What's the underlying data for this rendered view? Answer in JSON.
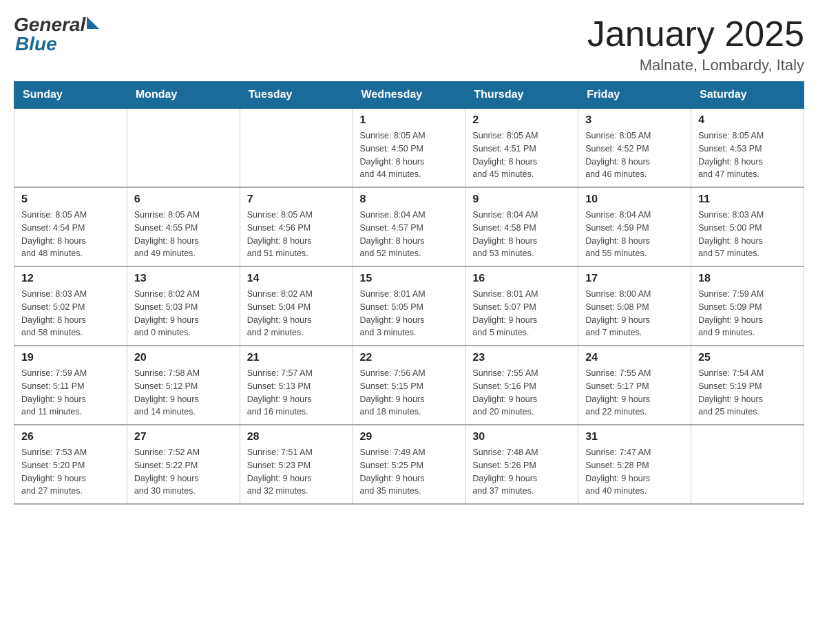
{
  "header": {
    "logo_general": "General",
    "logo_blue": "Blue",
    "month_title": "January 2025",
    "location": "Malnate, Lombardy, Italy"
  },
  "weekdays": [
    "Sunday",
    "Monday",
    "Tuesday",
    "Wednesday",
    "Thursday",
    "Friday",
    "Saturday"
  ],
  "weeks": [
    [
      {
        "day": "",
        "info": ""
      },
      {
        "day": "",
        "info": ""
      },
      {
        "day": "",
        "info": ""
      },
      {
        "day": "1",
        "info": "Sunrise: 8:05 AM\nSunset: 4:50 PM\nDaylight: 8 hours\nand 44 minutes."
      },
      {
        "day": "2",
        "info": "Sunrise: 8:05 AM\nSunset: 4:51 PM\nDaylight: 8 hours\nand 45 minutes."
      },
      {
        "day": "3",
        "info": "Sunrise: 8:05 AM\nSunset: 4:52 PM\nDaylight: 8 hours\nand 46 minutes."
      },
      {
        "day": "4",
        "info": "Sunrise: 8:05 AM\nSunset: 4:53 PM\nDaylight: 8 hours\nand 47 minutes."
      }
    ],
    [
      {
        "day": "5",
        "info": "Sunrise: 8:05 AM\nSunset: 4:54 PM\nDaylight: 8 hours\nand 48 minutes."
      },
      {
        "day": "6",
        "info": "Sunrise: 8:05 AM\nSunset: 4:55 PM\nDaylight: 8 hours\nand 49 minutes."
      },
      {
        "day": "7",
        "info": "Sunrise: 8:05 AM\nSunset: 4:56 PM\nDaylight: 8 hours\nand 51 minutes."
      },
      {
        "day": "8",
        "info": "Sunrise: 8:04 AM\nSunset: 4:57 PM\nDaylight: 8 hours\nand 52 minutes."
      },
      {
        "day": "9",
        "info": "Sunrise: 8:04 AM\nSunset: 4:58 PM\nDaylight: 8 hours\nand 53 minutes."
      },
      {
        "day": "10",
        "info": "Sunrise: 8:04 AM\nSunset: 4:59 PM\nDaylight: 8 hours\nand 55 minutes."
      },
      {
        "day": "11",
        "info": "Sunrise: 8:03 AM\nSunset: 5:00 PM\nDaylight: 8 hours\nand 57 minutes."
      }
    ],
    [
      {
        "day": "12",
        "info": "Sunrise: 8:03 AM\nSunset: 5:02 PM\nDaylight: 8 hours\nand 58 minutes."
      },
      {
        "day": "13",
        "info": "Sunrise: 8:02 AM\nSunset: 5:03 PM\nDaylight: 9 hours\nand 0 minutes."
      },
      {
        "day": "14",
        "info": "Sunrise: 8:02 AM\nSunset: 5:04 PM\nDaylight: 9 hours\nand 2 minutes."
      },
      {
        "day": "15",
        "info": "Sunrise: 8:01 AM\nSunset: 5:05 PM\nDaylight: 9 hours\nand 3 minutes."
      },
      {
        "day": "16",
        "info": "Sunrise: 8:01 AM\nSunset: 5:07 PM\nDaylight: 9 hours\nand 5 minutes."
      },
      {
        "day": "17",
        "info": "Sunrise: 8:00 AM\nSunset: 5:08 PM\nDaylight: 9 hours\nand 7 minutes."
      },
      {
        "day": "18",
        "info": "Sunrise: 7:59 AM\nSunset: 5:09 PM\nDaylight: 9 hours\nand 9 minutes."
      }
    ],
    [
      {
        "day": "19",
        "info": "Sunrise: 7:59 AM\nSunset: 5:11 PM\nDaylight: 9 hours\nand 11 minutes."
      },
      {
        "day": "20",
        "info": "Sunrise: 7:58 AM\nSunset: 5:12 PM\nDaylight: 9 hours\nand 14 minutes."
      },
      {
        "day": "21",
        "info": "Sunrise: 7:57 AM\nSunset: 5:13 PM\nDaylight: 9 hours\nand 16 minutes."
      },
      {
        "day": "22",
        "info": "Sunrise: 7:56 AM\nSunset: 5:15 PM\nDaylight: 9 hours\nand 18 minutes."
      },
      {
        "day": "23",
        "info": "Sunrise: 7:55 AM\nSunset: 5:16 PM\nDaylight: 9 hours\nand 20 minutes."
      },
      {
        "day": "24",
        "info": "Sunrise: 7:55 AM\nSunset: 5:17 PM\nDaylight: 9 hours\nand 22 minutes."
      },
      {
        "day": "25",
        "info": "Sunrise: 7:54 AM\nSunset: 5:19 PM\nDaylight: 9 hours\nand 25 minutes."
      }
    ],
    [
      {
        "day": "26",
        "info": "Sunrise: 7:53 AM\nSunset: 5:20 PM\nDaylight: 9 hours\nand 27 minutes."
      },
      {
        "day": "27",
        "info": "Sunrise: 7:52 AM\nSunset: 5:22 PM\nDaylight: 9 hours\nand 30 minutes."
      },
      {
        "day": "28",
        "info": "Sunrise: 7:51 AM\nSunset: 5:23 PM\nDaylight: 9 hours\nand 32 minutes."
      },
      {
        "day": "29",
        "info": "Sunrise: 7:49 AM\nSunset: 5:25 PM\nDaylight: 9 hours\nand 35 minutes."
      },
      {
        "day": "30",
        "info": "Sunrise: 7:48 AM\nSunset: 5:26 PM\nDaylight: 9 hours\nand 37 minutes."
      },
      {
        "day": "31",
        "info": "Sunrise: 7:47 AM\nSunset: 5:28 PM\nDaylight: 9 hours\nand 40 minutes."
      },
      {
        "day": "",
        "info": ""
      }
    ]
  ]
}
